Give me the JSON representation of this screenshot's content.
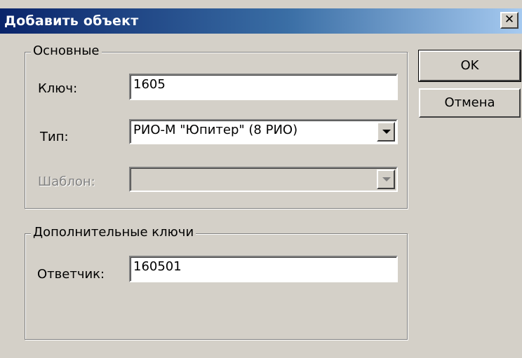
{
  "window": {
    "title": "Добавить объект",
    "close_glyph": "✕",
    "close_icon": "close-icon"
  },
  "main_group": {
    "legend": "Основные",
    "key": {
      "label": "Ключ:",
      "value": "1605"
    },
    "type": {
      "label": "Тип:",
      "value": "РИО-М \"Юпитер\" (8 РИО)"
    },
    "template": {
      "label": "Шаблон:",
      "value": ""
    }
  },
  "extra_group": {
    "legend": "Дополнительные ключи",
    "responder": {
      "label": "Ответчик:",
      "value": "160501"
    }
  },
  "buttons": {
    "ok": "OK",
    "cancel": "Отмена"
  },
  "colors": {
    "dialog_bg": "#d4d0c8",
    "title_start": "#0a246a",
    "title_end": "#a6caf0"
  }
}
